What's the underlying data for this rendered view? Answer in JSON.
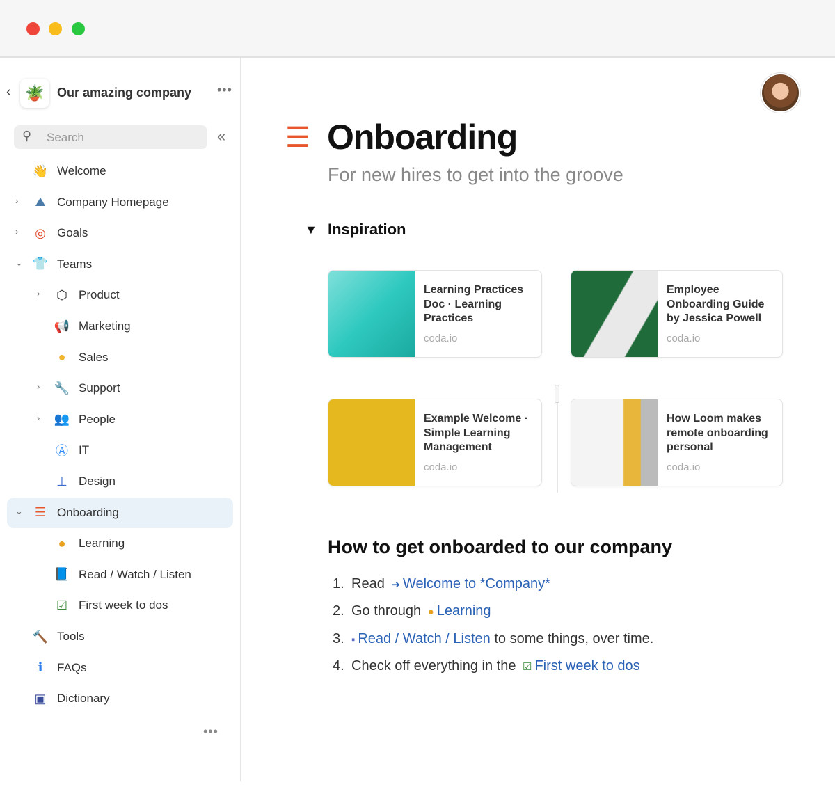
{
  "window": {
    "controls": [
      {
        "name": "close",
        "color": "#f0453a"
      },
      {
        "name": "minimize",
        "color": "#f8bd1c"
      },
      {
        "name": "maximize",
        "color": "#28c840"
      }
    ]
  },
  "sidebar": {
    "workspace_name": "Our amazing company",
    "search_placeholder": "Search",
    "items": [
      {
        "label": "Welcome",
        "icon": "waving-hand-icon",
        "level": 1,
        "chevron": ""
      },
      {
        "label": "Company Homepage",
        "icon": "mountain-flag-icon",
        "level": 1,
        "chevron": "›"
      },
      {
        "label": "Goals",
        "icon": "target-icon",
        "level": 1,
        "chevron": "›"
      },
      {
        "label": "Teams",
        "icon": "shirt-icon",
        "level": 1,
        "chevron": "⌄"
      },
      {
        "label": "Product",
        "icon": "cube-icon",
        "level": 2,
        "chevron": "›"
      },
      {
        "label": "Marketing",
        "icon": "megaphone-icon",
        "level": 2,
        "chevron": ""
      },
      {
        "label": "Sales",
        "icon": "coin-icon",
        "level": 2,
        "chevron": ""
      },
      {
        "label": "Support",
        "icon": "wrench-icon",
        "level": 2,
        "chevron": "›"
      },
      {
        "label": "People",
        "icon": "people-icon",
        "level": 2,
        "chevron": "›"
      },
      {
        "label": "IT",
        "icon": "app-store-icon",
        "level": 2,
        "chevron": ""
      },
      {
        "label": "Design",
        "icon": "org-chart-icon",
        "level": 2,
        "chevron": ""
      },
      {
        "label": "Onboarding",
        "icon": "ladder-icon",
        "level": 1,
        "chevron": "⌄",
        "active": true
      },
      {
        "label": "Learning",
        "icon": "brain-icon",
        "level": 2,
        "chevron": ""
      },
      {
        "label": "Read / Watch / Listen",
        "icon": "reading-icon",
        "level": 2,
        "chevron": ""
      },
      {
        "label": "First week to dos",
        "icon": "clipboard-check-icon",
        "level": 2,
        "chevron": ""
      },
      {
        "label": "Tools",
        "icon": "hammer-icon",
        "level": 1,
        "chevron": ""
      },
      {
        "label": "FAQs",
        "icon": "info-icon",
        "level": 1,
        "chevron": ""
      },
      {
        "label": "Dictionary",
        "icon": "dictionary-icon",
        "level": 1,
        "chevron": ""
      }
    ]
  },
  "page": {
    "title": "Onboarding",
    "subtitle": "For new hires to get into the groove",
    "section": "Inspiration",
    "cards": [
      {
        "title": "Learning Practices Doc · Learning Practices",
        "source": "coda.io"
      },
      {
        "title": "Employee Onboarding Guide by Jessica Powell",
        "source": "coda.io"
      },
      {
        "title": "Example Welcome · Simple Learning Management",
        "source": "coda.io"
      },
      {
        "title": "How Loom makes remote onboarding personal",
        "source": "coda.io"
      }
    ],
    "heading": "How to get onboarded to our company",
    "steps": [
      {
        "num": "1.",
        "pre": "Read",
        "link": "Welcome to *Company*",
        "post": ""
      },
      {
        "num": "2.",
        "pre": "Go through",
        "link": "Learning",
        "post": ""
      },
      {
        "num": "3.",
        "pre": "",
        "link": "Read / Watch / Listen",
        "post": "to some things, over time."
      },
      {
        "num": "4.",
        "pre": "Check off everything in the",
        "link": "First week to dos",
        "post": ""
      }
    ],
    "link_color": "#2a62b5"
  }
}
